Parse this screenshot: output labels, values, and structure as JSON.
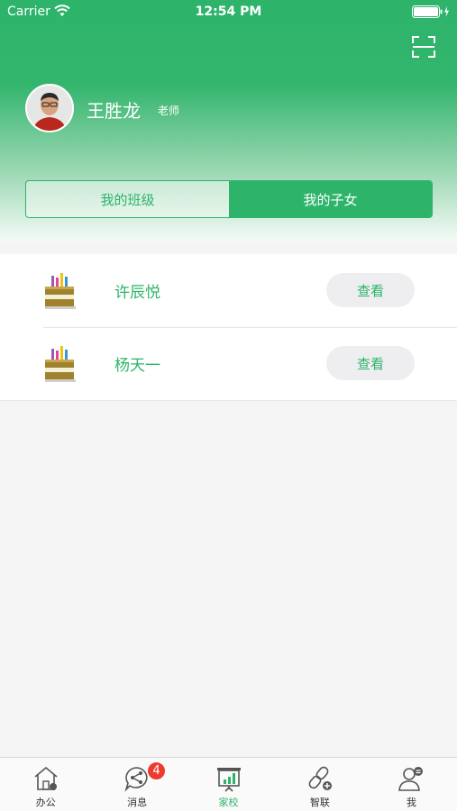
{
  "status_bar": {
    "carrier": "Carrier",
    "time": "12:54 PM"
  },
  "colors": {
    "brand_green": "#2db46a",
    "badge_red": "#ee3b2f"
  },
  "icons": {
    "scan": "scan-icon",
    "avatar": "avatar",
    "student": "pencil-box-icon"
  },
  "profile": {
    "name": "王胜龙",
    "role": "老师"
  },
  "segment": {
    "tabs": [
      {
        "label": "我的班级",
        "selected": false
      },
      {
        "label": "我的子女",
        "selected": true
      }
    ]
  },
  "children": [
    {
      "name": "许辰悦",
      "action_label": "查看"
    },
    {
      "name": "杨天一",
      "action_label": "查看"
    }
  ],
  "tabbar": {
    "items": [
      {
        "label": "办公",
        "icon": "house-icon"
      },
      {
        "label": "消息",
        "icon": "message-share-icon",
        "badge": "4"
      },
      {
        "label": "家校",
        "icon": "presentation-chart-icon",
        "active": true
      },
      {
        "label": "智联",
        "icon": "link-plus-icon"
      },
      {
        "label": "我",
        "icon": "user-icon"
      }
    ]
  }
}
